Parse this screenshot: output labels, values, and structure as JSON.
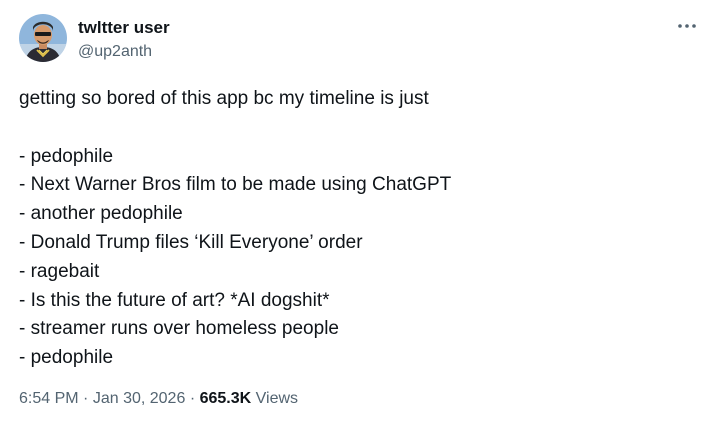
{
  "author": {
    "display_name": "twltter user",
    "handle": "@up2anth",
    "avatar_icon": "cartoon-avatar-icon"
  },
  "more_icon": "more-horizontal-icon",
  "tweet": {
    "intro": "getting so bored of this app bc my timeline is just",
    "list": [
      "- pedophile",
      "- Next Warner Bros film to be made using ChatGPT",
      "- another pedophile",
      "- Donald Trump files ‘Kill Everyone’ order",
      "- ragebait",
      "- Is this the future of art? *AI dogshit*",
      "- streamer runs over homeless people",
      "- pedophile"
    ]
  },
  "meta": {
    "time": "6:54 PM",
    "separator": "·",
    "date": "Jan 30, 2026",
    "views_count": "665.3K",
    "views_label": "Views"
  },
  "colors": {
    "text_primary": "#0f1419",
    "text_secondary": "#536471",
    "background": "#ffffff"
  }
}
